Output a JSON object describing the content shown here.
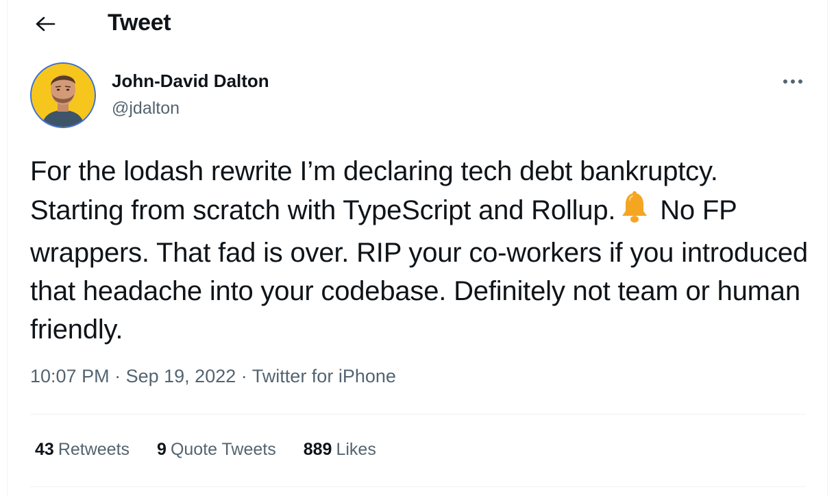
{
  "header": {
    "title": "Tweet"
  },
  "tweet": {
    "author_name": "John-David Dalton",
    "author_handle": "@jdalton",
    "text_part1": "For the lodash rewrite I’m declaring tech debt bankruptcy. Starting from scratch with TypeScript and Rollup.",
    "emoji": "bell",
    "text_part2": "No FP wrappers. That fad is over. RIP your co-workers if you introduced that headache into your codebase. Definitely not team or human friendly.",
    "time": "10:07 PM",
    "separator1": "·",
    "date": "Sep 19, 2022",
    "separator2": "·",
    "source": "Twitter for iPhone"
  },
  "stats": {
    "retweets_count": "43",
    "retweets_label": "Retweets",
    "quotes_count": "9",
    "quotes_label": "Quote Tweets",
    "likes_count": "889",
    "likes_label": "Likes"
  },
  "icons": {
    "back": "arrow-left-icon",
    "more": "more-horizontal-icon",
    "bell": "bell-emoji"
  },
  "colors": {
    "text": "#0f1419",
    "secondary": "#536471",
    "avatar_ring": "#3b6fd8",
    "avatar_bg": "#f6c61c",
    "bell": "#f4a622"
  }
}
